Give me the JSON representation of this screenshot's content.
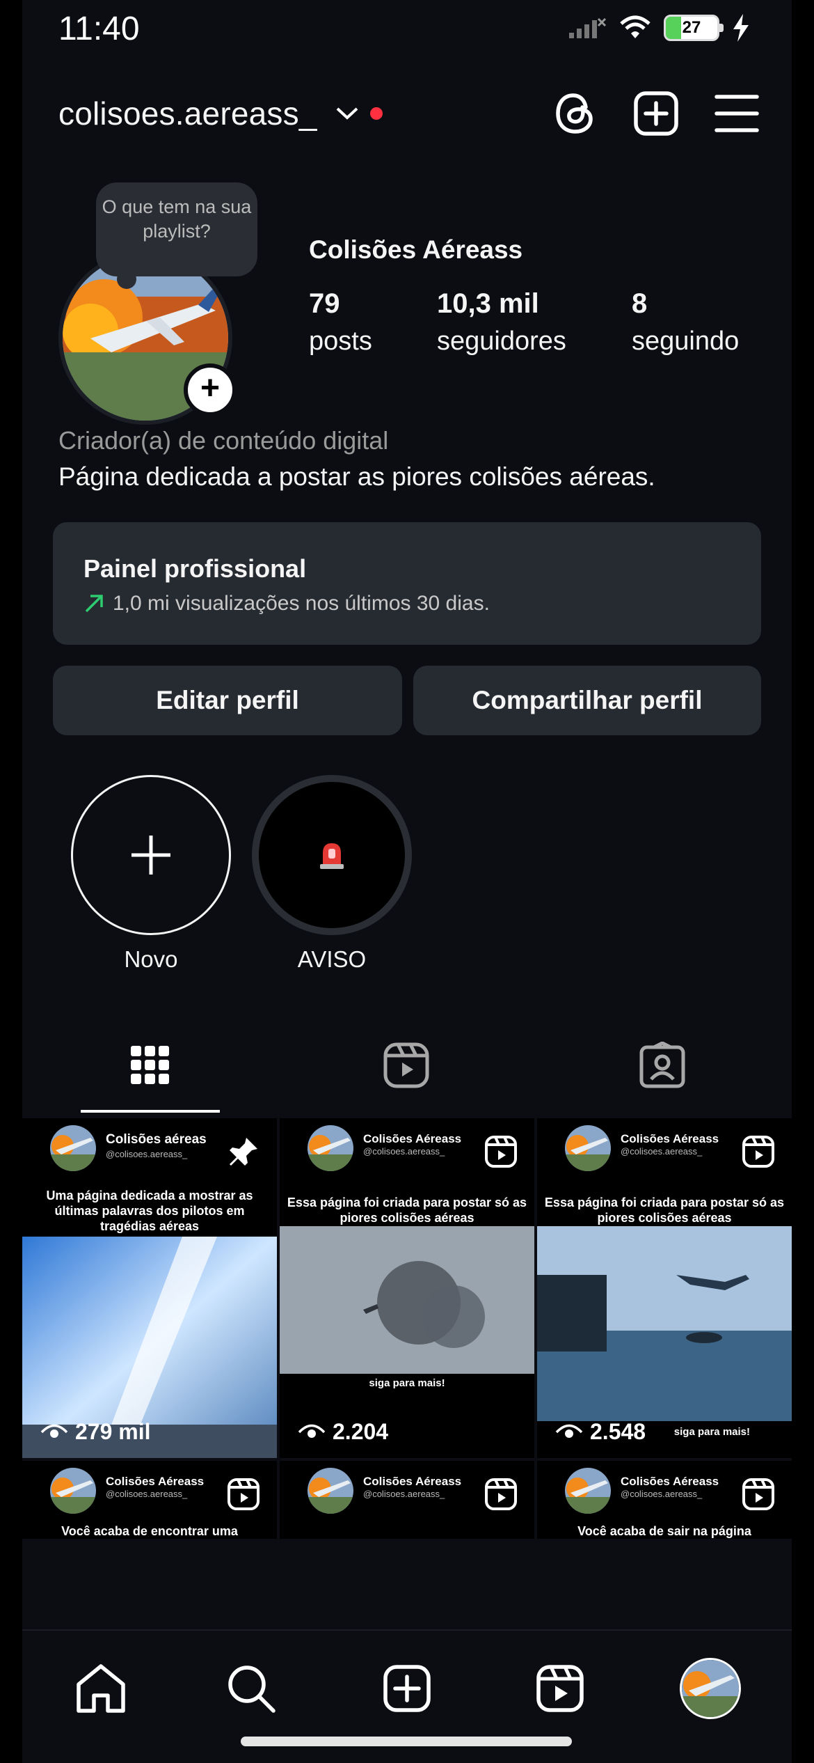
{
  "status_bar": {
    "time": "11:40",
    "battery": "27",
    "icons": [
      "signal-icon",
      "wifi-icon",
      "battery-icon",
      "charging-icon"
    ]
  },
  "header": {
    "username": "colisoes.aereass_",
    "icons": [
      "chevron-down-icon",
      "notification-dot",
      "threads-icon",
      "create-post-icon",
      "menu-icon"
    ]
  },
  "profile": {
    "note": "O que tem na sua playlist?",
    "display_name": "Colisões Aéreass",
    "stats": [
      {
        "value": "79",
        "label": "posts"
      },
      {
        "value": "10,3 mil",
        "label": "seguidores"
      },
      {
        "value": "8",
        "label": "seguindo"
      }
    ],
    "category": "Criador(a) de conteúdo digital",
    "bio": "Página dedicada a postar as piores colisões aéreas."
  },
  "dashboard": {
    "title": "Painel profissional",
    "subtitle": "1,0 mi visualizações nos últimos 30 dias."
  },
  "actions": {
    "edit": "Editar perfil",
    "share": "Compartilhar perfil"
  },
  "highlights": [
    {
      "label": "Novo",
      "icon": "plus-icon"
    },
    {
      "label": "AVISO",
      "icon": "siren-icon"
    }
  ],
  "tabs": [
    "grid-icon",
    "reels-icon",
    "tagged-icon"
  ],
  "posts": [
    {
      "name": "Colisões aéreas",
      "handle": "@colisoes.aereass_",
      "caption": "Uma página dedicada a mostrar as últimas palavras dos pilotos em tragédias aéreas",
      "views": "279 mil",
      "badge": "pin-icon"
    },
    {
      "name": "Colisões Aéreass",
      "handle": "@colisoes.aereass_",
      "caption": "Essa página foi criada para postar só as piores colisões aéreas",
      "footer": "siga para mais!",
      "views": "2.204",
      "badge": "reel-icon"
    },
    {
      "name": "Colisões Aéreass",
      "handle": "@colisoes.aereass_",
      "caption": "Essa página foi criada para postar só as piores colisões aéreas",
      "footer": "siga para mais!",
      "views": "2.548",
      "badge": "reel-icon"
    },
    {
      "name": "Colisões Aéreass",
      "handle": "@colisoes.aereass_",
      "caption": "Você acaba de encontrar uma",
      "badge": "reel-icon"
    },
    {
      "name": "Colisões Aéreass",
      "handle": "@colisoes.aereass_",
      "caption": "",
      "badge": "reel-icon"
    },
    {
      "name": "Colisões Aéreass",
      "handle": "@colisoes.aereass_",
      "caption": "Você acaba de sair na página",
      "badge": "reel-icon"
    }
  ],
  "bottom_nav": [
    "home-icon",
    "search-icon",
    "create-icon",
    "reels-icon",
    "profile-avatar"
  ]
}
